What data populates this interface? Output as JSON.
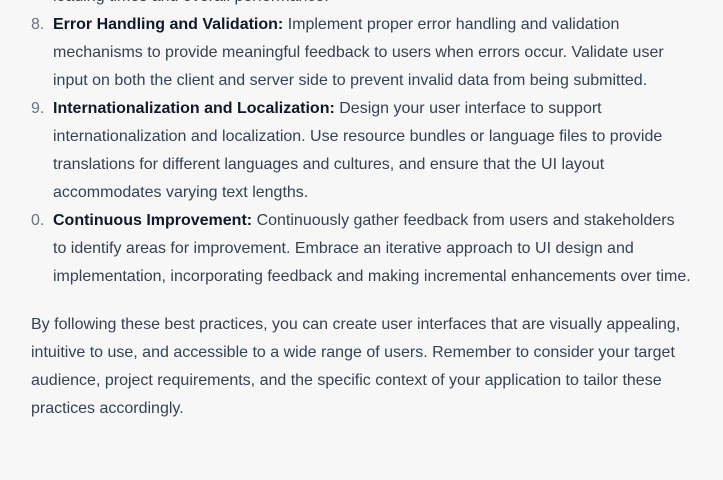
{
  "message": {
    "top_fragment": "loading times and overall performance.",
    "items": [
      {
        "number": "8.",
        "title": "Error Handling and Validation:",
        "text": "Implement proper error handling and validation mechanisms to provide meaningful feedback to users when errors occur. Validate user input on both the client and server side to prevent invalid data from being submitted."
      },
      {
        "number": "9.",
        "title": "Internationalization and Localization:",
        "text": "Design your user interface to support internationalization and localization. Use resource bundles or language files to provide translations for different languages and cultures, and ensure that the UI layout accommodates varying text lengths."
      },
      {
        "number": "0.",
        "title": "Continuous Improvement:",
        "text": "Continuously gather feedback from users and stakeholders to identify areas for improvement. Embrace an iterative approach to UI design and implementation, incorporating feedback and making incremental enhancements over time."
      }
    ],
    "closing": "By following these best practices, you can create user interfaces that are visually appealing, intuitive to use, and accessible to a wide range of users. Remember to consider your target audience, project requirements, and the specific context of your application to tailor these practices accordingly."
  }
}
